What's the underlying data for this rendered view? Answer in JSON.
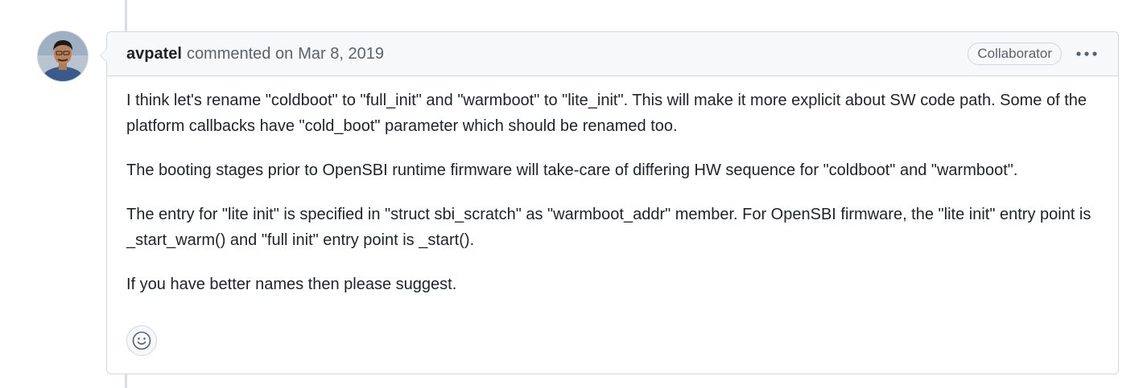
{
  "comment": {
    "author": "avpatel",
    "action": "commented on",
    "date": "Mar 8, 2019",
    "role_badge": "Collaborator",
    "paragraphs": [
      "I think let's rename \"coldboot\" to \"full_init\" and \"warmboot\" to \"lite_init\". This will make it more explicit about SW code path. Some of the platform callbacks have \"cold_boot\" parameter which should be renamed too.",
      "The booting stages prior to OpenSBI runtime firmware will take-care of differing HW sequence for \"coldboot\" and \"warmboot\".",
      "The entry for \"lite init\" is specified in \"struct sbi_scratch\" as \"warmboot_addr\" member. For OpenSBI firmware, the \"lite init\" entry point is _start_warm() and \"full init\" entry point is _start().",
      "If you have better names then please suggest."
    ]
  },
  "icons": {
    "avatar": "user-avatar",
    "more_options": "kebab-horizontal-icon",
    "reaction": "smiley-icon"
  },
  "colors": {
    "border": "#d0d7de",
    "header_bg": "#f6f8fa",
    "muted_text": "#59636e",
    "text": "#1f2328"
  }
}
